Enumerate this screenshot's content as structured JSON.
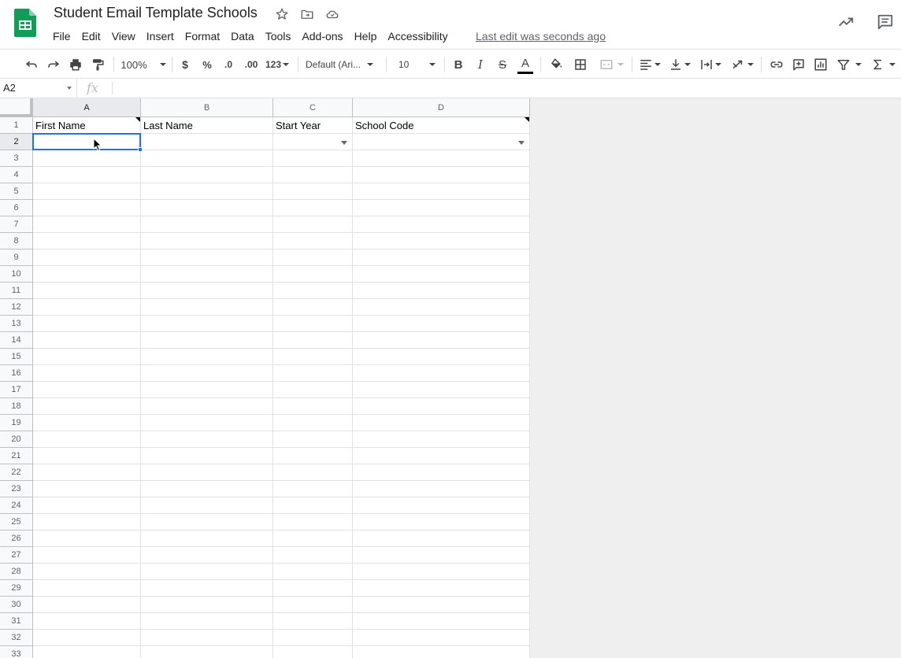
{
  "document": {
    "title": "Student Email Template Schools",
    "last_edit": "Last edit was seconds ago"
  },
  "menu": [
    "File",
    "Edit",
    "View",
    "Insert",
    "Format",
    "Data",
    "Tools",
    "Add-ons",
    "Help",
    "Accessibility"
  ],
  "toolbar": {
    "zoom": "100%",
    "currency": "$",
    "percent": "%",
    "decrease_decimals": ".0",
    "increase_decimals": ".00",
    "number_format": "123",
    "font": "Default (Ari...",
    "font_size": "10",
    "bold": "B",
    "italic": "I",
    "strikethrough": "S",
    "text_color": "A"
  },
  "formula_bar": {
    "cell_ref": "A2",
    "fx": "fx",
    "value": ""
  },
  "sheet": {
    "columns": [
      "A",
      "B",
      "C",
      "D"
    ],
    "active_column": "A",
    "active_row": 2,
    "rows": [
      [
        "First Name",
        "Last Name",
        "Start Year",
        "School Code"
      ],
      [
        "",
        "",
        "",
        ""
      ]
    ],
    "row_numbers": [
      1,
      2,
      3,
      4,
      5,
      6,
      7,
      8,
      9,
      10,
      11,
      12,
      13,
      14,
      15,
      16,
      17,
      18,
      19,
      20,
      21,
      22,
      23,
      24,
      25,
      26,
      27,
      28,
      29,
      30,
      31,
      32,
      33
    ],
    "note_cells": [
      "A1",
      "D1"
    ],
    "dropdown_cells": [
      "C2",
      "D2"
    ],
    "selected_cell": "A2"
  },
  "colors": {
    "selection": "#1a73e8",
    "logo_green": "#0f9d58"
  }
}
